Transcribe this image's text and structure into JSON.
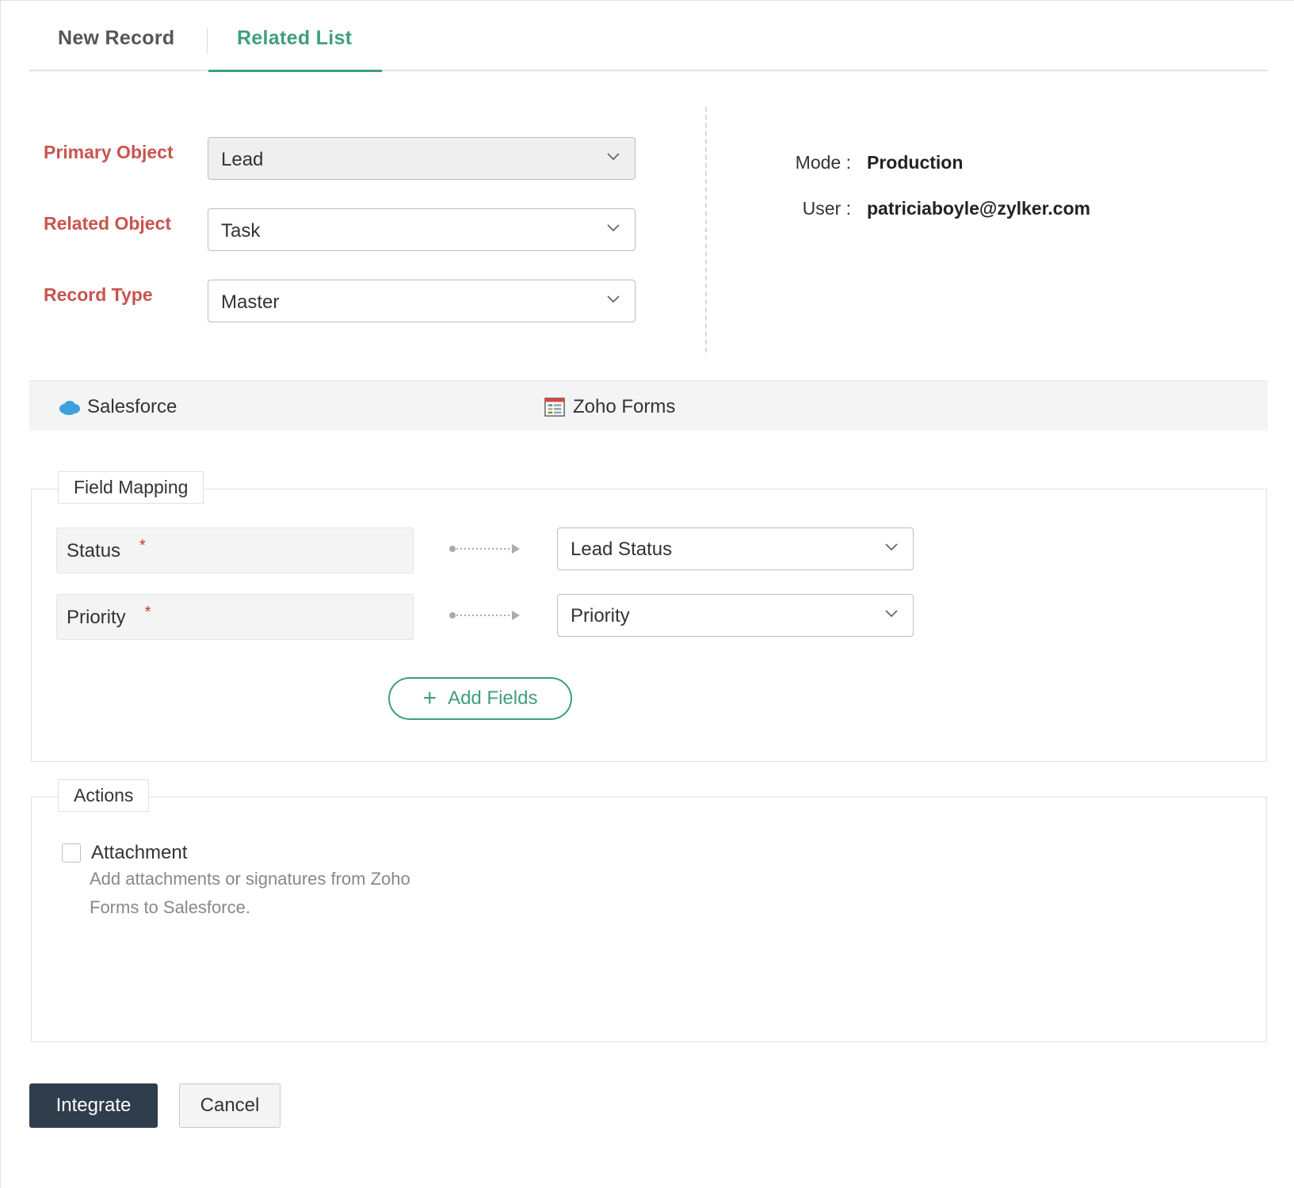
{
  "tabs": [
    {
      "label": "New Record",
      "active": false
    },
    {
      "label": "Related List",
      "active": true
    }
  ],
  "config": {
    "primary_object": {
      "label": "Primary Object",
      "value": "Lead",
      "disabled": true
    },
    "related_object": {
      "label": "Related Object",
      "value": "Task"
    },
    "record_type": {
      "label": "Record Type",
      "value": "Master"
    }
  },
  "info": {
    "mode_key": "Mode :",
    "mode_value": "Production",
    "user_key": "User :",
    "user_value": "patriciaboyle@zylker.com"
  },
  "apps": {
    "source": {
      "name": "Salesforce",
      "icon": "salesforce-cloud-icon"
    },
    "target": {
      "name": "Zoho Forms",
      "icon": "zoho-forms-icon"
    }
  },
  "field_mapping": {
    "legend": "Field Mapping",
    "rows": [
      {
        "source": "Status",
        "required_mark": "*",
        "target": "Lead Status"
      },
      {
        "source": "Priority",
        "required_mark": "*",
        "target": "Priority"
      }
    ],
    "add_fields_label": "Add Fields",
    "add_icon": "plus-icon"
  },
  "actions": {
    "legend": "Actions",
    "attachment": {
      "label": "Attachment",
      "checked": false,
      "description": "Add attachments or signatures from Zoho Forms to Salesforce."
    }
  },
  "buttons": {
    "integrate": "Integrate",
    "cancel": "Cancel"
  },
  "colors": {
    "accent": "#3f9e7f",
    "label_red": "#c85450",
    "required_red": "#d1342f",
    "primary_button": "#2f3d4c"
  }
}
